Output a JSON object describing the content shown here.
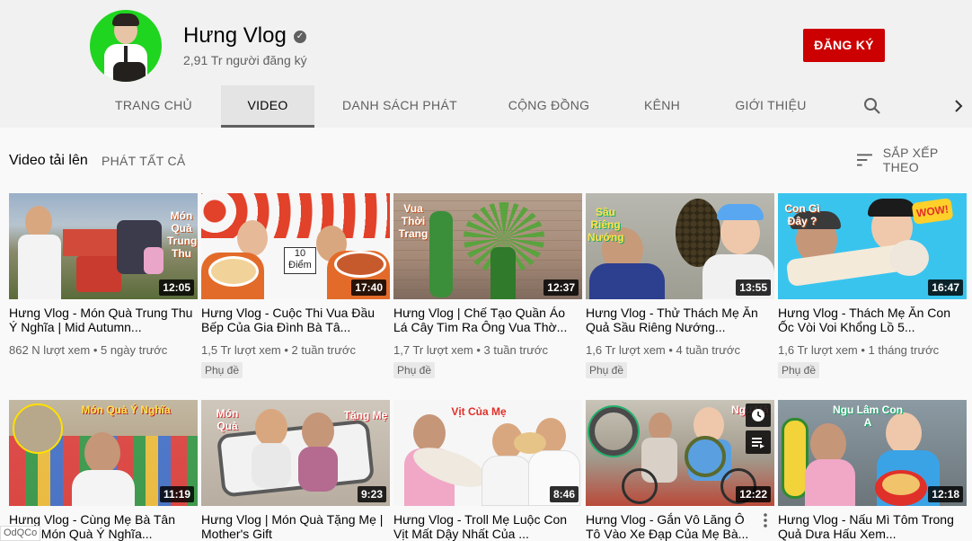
{
  "channel": {
    "name": "Hưng Vlog",
    "subscribers": "2,91 Tr người đăng ký",
    "subscribe_label": "ĐĂNG KÝ",
    "verified_icon": "check-circle-icon"
  },
  "tabs": [
    {
      "label": "TRANG CHỦ"
    },
    {
      "label": "VIDEO"
    },
    {
      "label": "DANH SÁCH PHÁT"
    },
    {
      "label": "CỘNG ĐỒNG"
    },
    {
      "label": "KÊNH"
    },
    {
      "label": "GIỚI THIỆU"
    }
  ],
  "section": {
    "title": "Video tải lên",
    "play_all": "PHÁT TẤT CẢ",
    "sort_label": "SẮP XẾP THEO"
  },
  "videos": [
    {
      "title": "Hưng Vlog - Món Quà Trung Thu Ý Nghĩa | Mid Autumn...",
      "views": "862 N lượt xem",
      "age": "5 ngày trước",
      "duration": "12:05",
      "badge": "",
      "overlay": "Món Quà Trung Thu"
    },
    {
      "title": "Hưng Vlog - Cuộc Thi Vua Đầu Bếp Của Gia Đình Bà Tâ...",
      "views": "1,5 Tr lượt xem",
      "age": "2 tuần trước",
      "duration": "17:40",
      "badge": "Phụ đề",
      "overlay": "10 Điểm"
    },
    {
      "title": "Hưng Vlog | Chế Tạo Quần Áo Lá Cây Tìm Ra Ông Vua Thờ...",
      "views": "1,7 Tr lượt xem",
      "age": "3 tuần trước",
      "duration": "12:37",
      "badge": "Phụ đề",
      "overlay": "Vua Thời Trang"
    },
    {
      "title": "Hưng Vlog - Thử Thách Mẹ Ăn Quả Sầu Riêng Nướng...",
      "views": "1,6 Tr lượt xem",
      "age": "4 tuần trước",
      "duration": "13:55",
      "badge": "Phụ đề",
      "overlay": "Sầu Riêng Nướng"
    },
    {
      "title": "Hưng Vlog - Thách Mẹ Ăn Con Ốc Vòi Voi Khổng Lồ 5...",
      "views": "1,6 Tr lượt xem",
      "age": "1 tháng trước",
      "duration": "16:47",
      "badge": "Phụ đề",
      "overlay": "Con Gì Đây ?"
    },
    {
      "title": "Hưng Vlog - Cùng Mẹ Bà Tân Tặng Món Quà Ý Nghĩa...",
      "views": "",
      "age": "",
      "duration": "11:19",
      "badge": "",
      "overlay": "Món Quà Ý Nghĩa"
    },
    {
      "title": "Hưng Vlog | Món Quà Tặng Mẹ | Mother's Gift",
      "views": "",
      "age": "",
      "duration": "9:23",
      "badge": "",
      "overlay": "Món Quà"
    },
    {
      "title": "Hưng Vlog - Troll Mẹ Luộc Con Vịt Mất Dậy Nhất Của ...",
      "views": "",
      "age": "",
      "duration": "8:46",
      "badge": "",
      "overlay": "Vịt Của Mẹ"
    },
    {
      "title": "Hưng Vlog - Gắn Vô Lăng Ô Tô Vào Xe Đạp Của Mẹ Bà...",
      "views": "",
      "age": "",
      "duration": "12:22",
      "badge": "",
      "overlay": "Ngu Hà"
    },
    {
      "title": "Hưng Vlog - Nấu Mì Tôm Trong Quả Dưa Hấu Xem...",
      "views": "",
      "age": "",
      "duration": "12:18",
      "badge": "",
      "overlay": "Ngu Lâm Con A"
    }
  ],
  "overlay_extra": {
    "v2_tang_me": "Tặng Mẹ"
  },
  "status_tag": "OdQCo",
  "colors": {
    "brand_red": "#cc0000",
    "text_secondary": "#606060",
    "background": "#f9f9f9",
    "header_bg": "#f1f1f1"
  }
}
